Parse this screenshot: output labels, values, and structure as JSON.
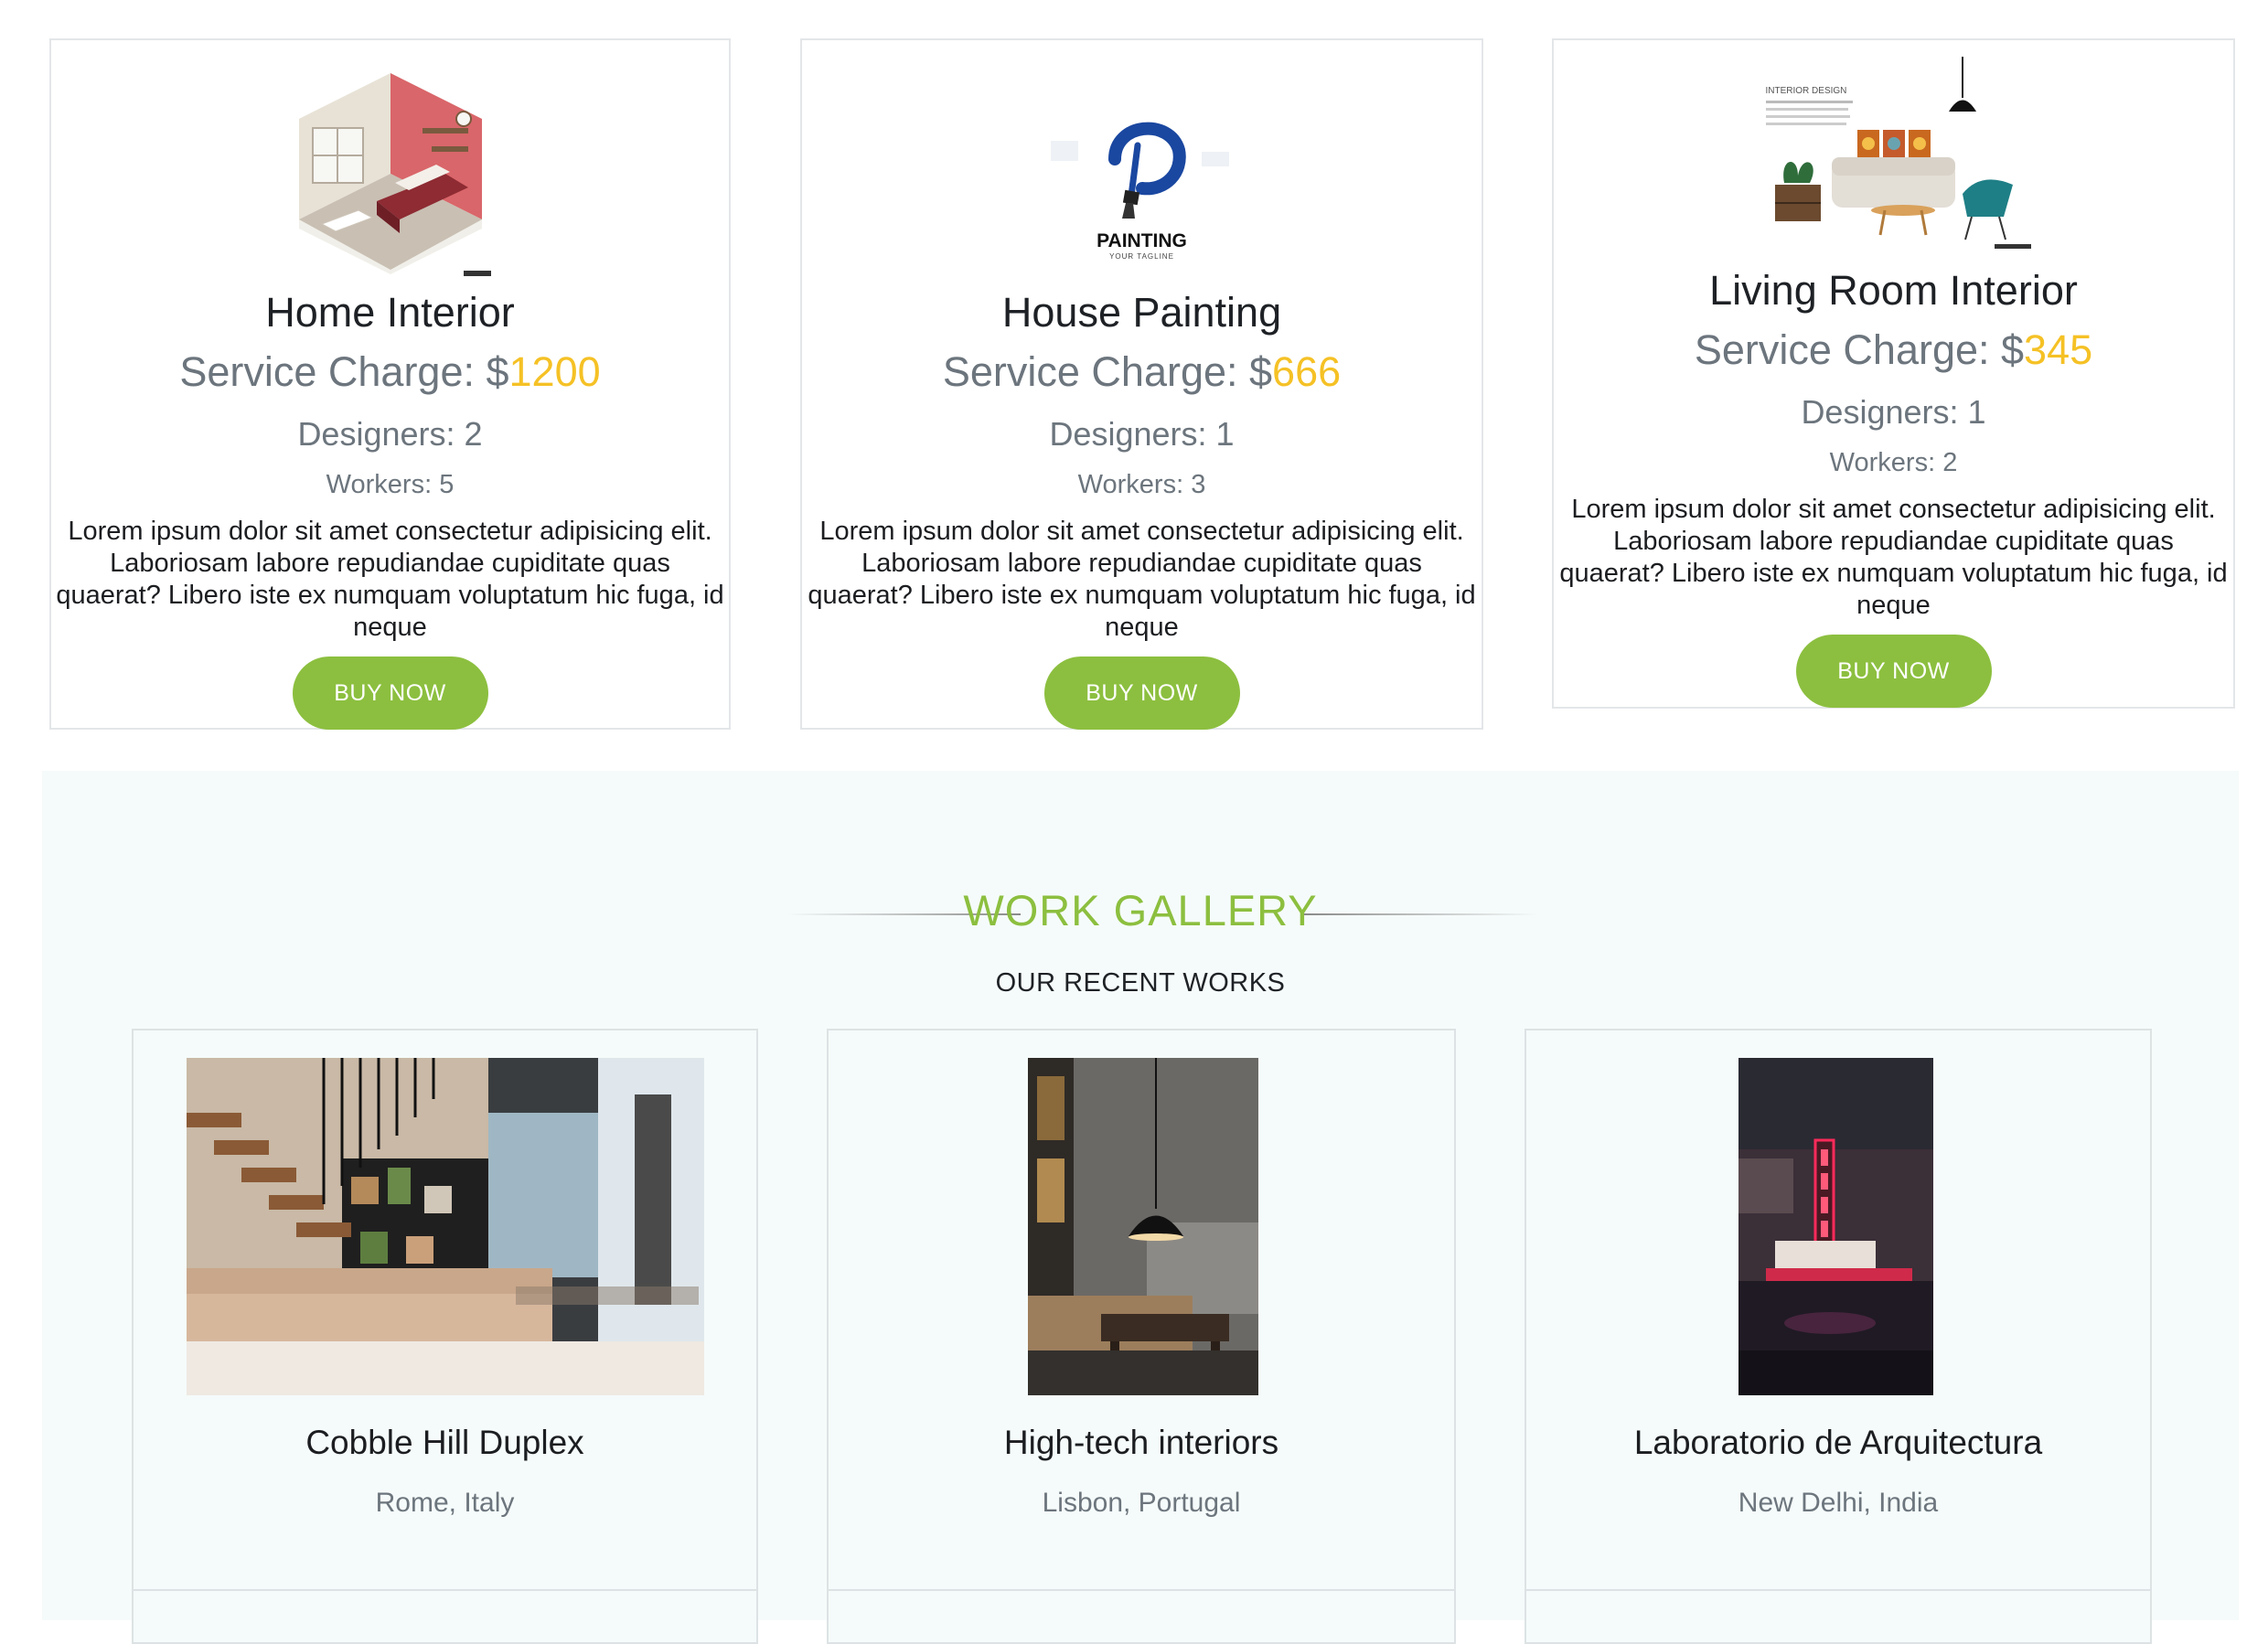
{
  "services": [
    {
      "title": "Home Interior",
      "charge_label": "Service Charge: $",
      "charge_amount": "1200",
      "designers": "Designers: 2",
      "workers": "Workers: 5",
      "description": "Lorem ipsum dolor sit amet consectetur adipisicing elit. Laboriosam labore repudiandae cupiditate quas quaerat? Libero iste ex numquam voluptatum hic fuga, id neque",
      "button": "BUY NOW",
      "image_icon": "isometric-bedroom-illustration"
    },
    {
      "title": "House Painting",
      "charge_label": "Service Charge: $",
      "charge_amount": "666",
      "designers": "Designers: 1",
      "workers": "Workers: 3",
      "description": "Lorem ipsum dolor sit amet consectetur adipisicing elit. Laboriosam labore repudiandae cupiditate quas quaerat? Libero iste ex numquam voluptatum hic fuga, id neque",
      "button": "BUY NOW",
      "image_icon": "painting-logo",
      "logo_text": "PAINTING",
      "logo_tagline": "YOUR TAGLINE"
    },
    {
      "title": "Living Room Interior",
      "charge_label": "Service Charge: $",
      "charge_amount": "345",
      "designers": "Designers: 1",
      "workers": "Workers: 2",
      "description": "Lorem ipsum dolor sit amet consectetur adipisicing elit. Laboriosam labore repudiandae cupiditate quas quaerat? Libero iste ex numquam voluptatum hic fuga, id neque",
      "button": "BUY NOW",
      "image_icon": "living-room-illustration",
      "image_caption": "INTERIOR DESIGN"
    }
  ],
  "gallery": {
    "title": "WORK GALLERY",
    "subtitle": "OUR RECENT WORKS",
    "works": [
      {
        "title": "Cobble Hill Duplex",
        "location": "Rome, Italy",
        "image_icon": "staircase-living-room-photo"
      },
      {
        "title": "High-tech interiors",
        "location": "Lisbon, Portugal",
        "image_icon": "pendant-lamp-lounge-photo"
      },
      {
        "title": "Laboratorio de Arquitectura",
        "location": "New Delhi, India",
        "image_icon": "neon-theatre-sign-photo"
      }
    ]
  },
  "colors": {
    "accent_green": "#8cbf3f",
    "price_yellow": "#f5c125",
    "muted_gray": "#6c757d",
    "gallery_bg": "#f5fbfa"
  }
}
